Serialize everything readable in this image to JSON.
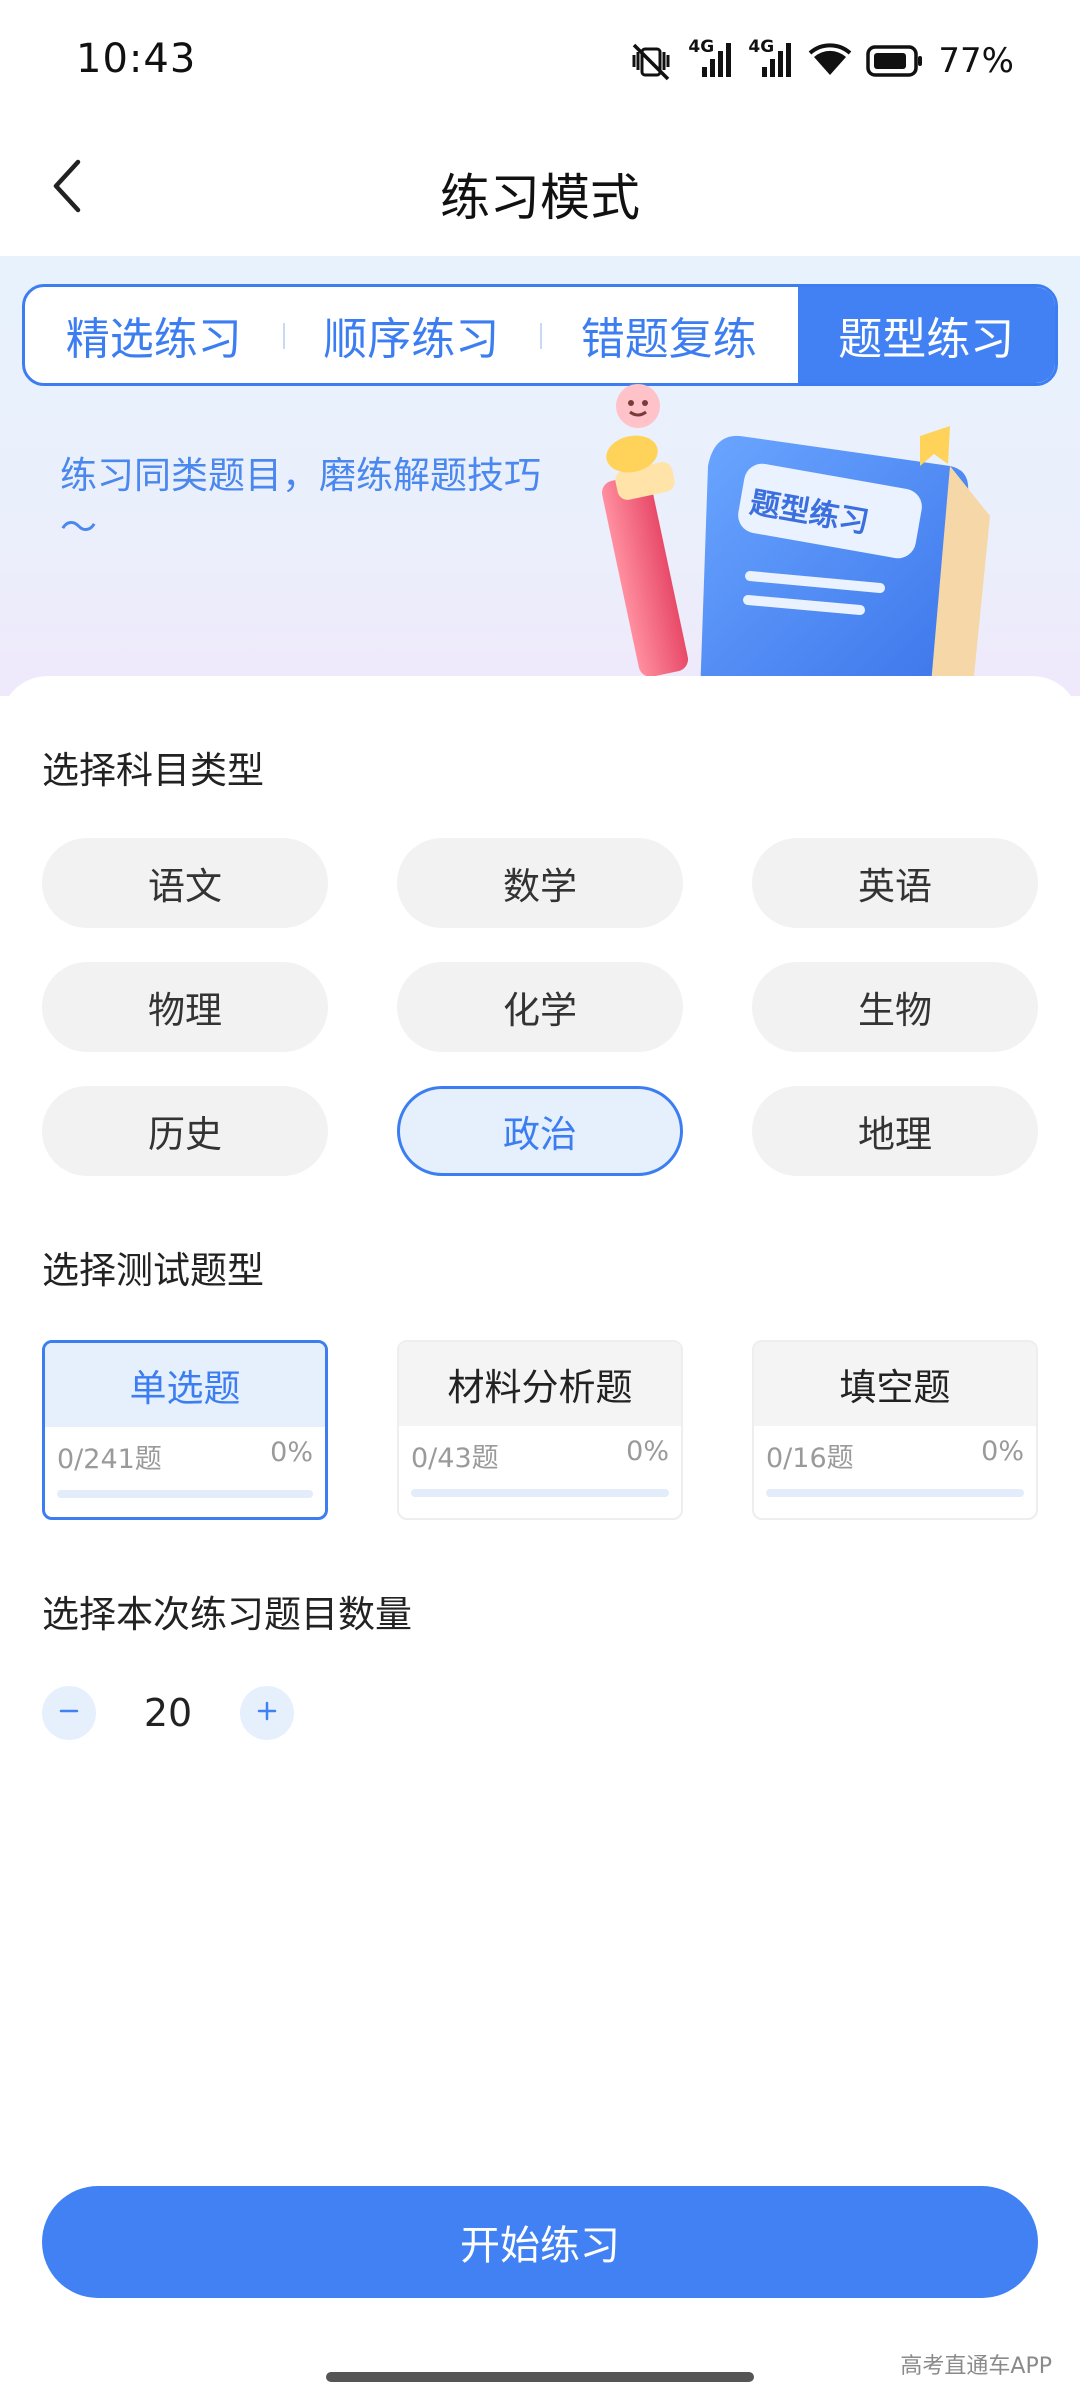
{
  "status_bar": {
    "time": "10:43",
    "network_1": "4G",
    "network_2": "4G",
    "battery": "77%",
    "icons": [
      "vibrate-off-icon",
      "signal-icon",
      "signal-icon",
      "wifi-icon",
      "battery-icon"
    ]
  },
  "nav": {
    "title": "练习模式",
    "back_icon": "back-arrow-icon"
  },
  "tabs": [
    {
      "label": "精选练习",
      "active": false
    },
    {
      "label": "顺序练习",
      "active": false
    },
    {
      "label": "错题复练",
      "active": false
    },
    {
      "label": "题型练习",
      "active": true
    }
  ],
  "banner": {
    "description": "练习同类题目，磨练解题技巧～",
    "book_label": "题型练习"
  },
  "subjects": {
    "title": "选择科目类型",
    "items": [
      {
        "label": "语文",
        "selected": false
      },
      {
        "label": "数学",
        "selected": false
      },
      {
        "label": "英语",
        "selected": false
      },
      {
        "label": "物理",
        "selected": false
      },
      {
        "label": "化学",
        "selected": false
      },
      {
        "label": "生物",
        "selected": false
      },
      {
        "label": "历史",
        "selected": false
      },
      {
        "label": "政治",
        "selected": true
      },
      {
        "label": "地理",
        "selected": false
      }
    ]
  },
  "question_types": {
    "title": "选择测试题型",
    "items": [
      {
        "label": "单选题",
        "count": "0/241题",
        "percent": "0%",
        "progress": 0,
        "selected": true
      },
      {
        "label": "材料分析题",
        "count": "0/43题",
        "percent": "0%",
        "progress": 0,
        "selected": false
      },
      {
        "label": "填空题",
        "count": "0/16题",
        "percent": "0%",
        "progress": 0,
        "selected": false
      }
    ]
  },
  "quantity": {
    "title": "选择本次练习题目数量",
    "value": "20",
    "minus_icon": "minus-icon",
    "plus_icon": "plus-icon"
  },
  "start_button": "开始练习",
  "watermark": "高考直通车APP",
  "colors": {
    "accent": "#4181f3",
    "accent_light": "#e6f0fd",
    "chip_bg": "#f2f2f2"
  }
}
